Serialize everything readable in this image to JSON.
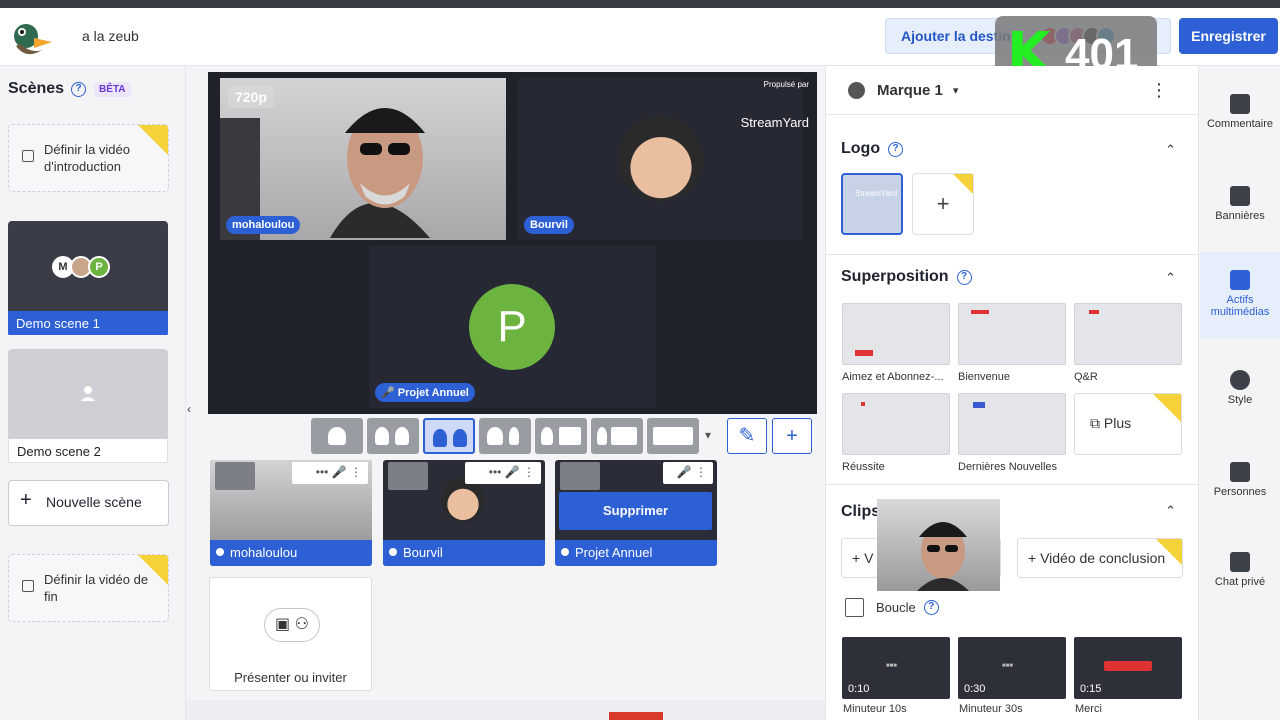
{
  "header": {
    "show_title": "a la zeub",
    "destinations_label": "Ajouter la destin",
    "save_label": "Enregistrer",
    "overlay_badge_letter": "K",
    "overlay_badge_number": "401",
    "destination_colors": [
      "#ff0000",
      "#9146ff",
      "#c13584",
      "#111111",
      "#1da1f2"
    ]
  },
  "scenes": {
    "title": "Scènes",
    "beta": "BÊTA",
    "intro_label": "Définir la vidéo d'introduction",
    "items": [
      {
        "label": "Demo scene 1",
        "avatars": [
          "M",
          "",
          "P"
        ]
      },
      {
        "label": "Demo scene 2"
      }
    ],
    "new_scene": "Nouvelle scène",
    "outro_label": "Définir la vidéo de fin"
  },
  "stage": {
    "resolution": "720p",
    "powered_by": "Propulsé par",
    "brand_name": "StreamYard",
    "participants": [
      {
        "name": "mohaloulou"
      },
      {
        "name": "Bourvil"
      },
      {
        "name": "Projet Annuel",
        "initial": "P"
      }
    ]
  },
  "backstage": {
    "tiles": [
      {
        "name": "mohaloulou"
      },
      {
        "name": "Bourvil"
      },
      {
        "name": "Projet Annuel",
        "action": "Supprimer"
      }
    ],
    "present_label": "Présenter ou inviter"
  },
  "brand_panel": {
    "brand_name": "Marque 1",
    "logo_title": "Logo",
    "logo_text": "StreamYard",
    "overlay_title": "Superposition",
    "overlays": [
      "Aimez et Abonnez-...",
      "Bienvenue",
      "Q&R",
      "Réussite",
      "Dernières Nouvelles"
    ],
    "more_label": "Plus",
    "clips_title": "Clips",
    "clip_buttons": [
      "V",
      "Vidéo de conclusion"
    ],
    "loop_label": "Boucle",
    "clips": [
      {
        "duration": "0:10",
        "name": "Minuteur 10s"
      },
      {
        "duration": "0:30",
        "name": "Minuteur 30s"
      },
      {
        "duration": "0:15",
        "name": "Merci"
      }
    ]
  },
  "rail": [
    {
      "label": "Commentaire",
      "icon": "comment-icon"
    },
    {
      "label": "Bannières",
      "icon": "banner-icon"
    },
    {
      "label": "Actifs multimédias",
      "icon": "media-icon"
    },
    {
      "label": "Style",
      "icon": "palette-icon"
    },
    {
      "label": "Personnes",
      "icon": "people-icon"
    },
    {
      "label": "Chat privé",
      "icon": "chat-icon"
    }
  ]
}
